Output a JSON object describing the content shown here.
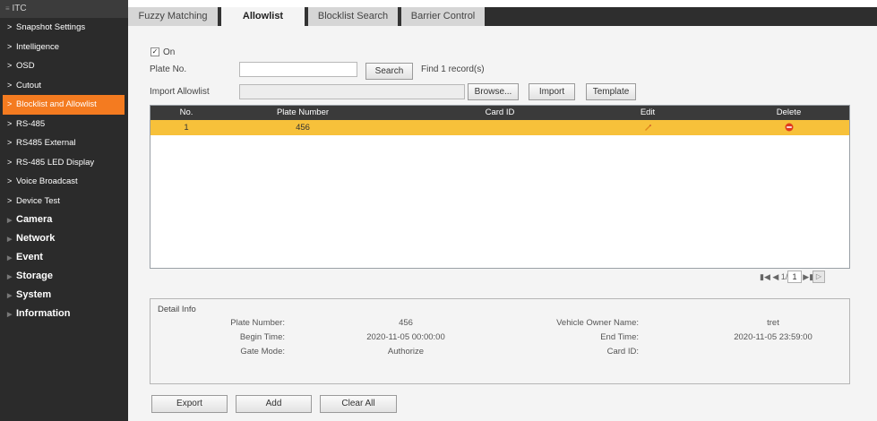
{
  "sidebar": {
    "header": "ITC",
    "sub_items": [
      {
        "label": "Snapshot Settings",
        "active": false
      },
      {
        "label": "Intelligence",
        "active": false
      },
      {
        "label": "OSD",
        "active": false
      },
      {
        "label": "Cutout",
        "active": false
      },
      {
        "label": "Blocklist and Allowlist",
        "active": true
      },
      {
        "label": "RS-485",
        "active": false
      },
      {
        "label": "RS485 External",
        "active": false
      },
      {
        "label": "RS-485 LED Display",
        "active": false
      },
      {
        "label": "Voice Broadcast",
        "active": false
      },
      {
        "label": "Device Test",
        "active": false
      }
    ],
    "top_items": [
      {
        "label": "Camera"
      },
      {
        "label": "Network"
      },
      {
        "label": "Event"
      },
      {
        "label": "Storage"
      },
      {
        "label": "System"
      },
      {
        "label": "Information"
      }
    ]
  },
  "tabs": [
    {
      "label": "Fuzzy Matching",
      "active": false
    },
    {
      "label": "Allowlist",
      "active": true
    },
    {
      "label": "Blocklist Search",
      "active": false
    },
    {
      "label": "Barrier Control",
      "active": false
    }
  ],
  "form": {
    "on_checked": true,
    "on_label": "On",
    "plate_label": "Plate No.",
    "plate_value": "",
    "search_button": "Search",
    "find_text": "Find  1  record(s)",
    "import_label": "Import Allowlist",
    "import_path": "",
    "browse_button": "Browse...",
    "import_button": "Import",
    "template_button": "Template"
  },
  "table": {
    "columns": [
      "No.",
      "Plate Number",
      "Card ID",
      "Edit",
      "Delete"
    ],
    "rows": [
      {
        "no": "1",
        "plate": "456",
        "card_id": ""
      }
    ],
    "edit_icon": "pencil-icon",
    "delete_icon": "delete-circle-icon"
  },
  "pagination": {
    "page_text": "1/1",
    "page_input": "1"
  },
  "detail": {
    "title": "Detail Info",
    "plate_number_label": "Plate Number:",
    "plate_number_value": "456",
    "owner_label": "Vehicle Owner Name:",
    "owner_value": "tret",
    "begin_label": "Begin Time:",
    "begin_value": "2020-11-05 00:00:00",
    "end_label": "End Time:",
    "end_value": "2020-11-05 23:59:00",
    "gate_label": "Gate Mode:",
    "gate_value": "Authorize",
    "card_label": "Card ID:",
    "card_value": ""
  },
  "footer_buttons": {
    "export": "Export",
    "add": "Add",
    "clear_all": "Clear All"
  },
  "colors": {
    "accent": "#f47b20",
    "row_highlight": "#f7c13a",
    "sidebar_bg": "#2b2b2b",
    "header_bg": "#3a3a3a"
  }
}
